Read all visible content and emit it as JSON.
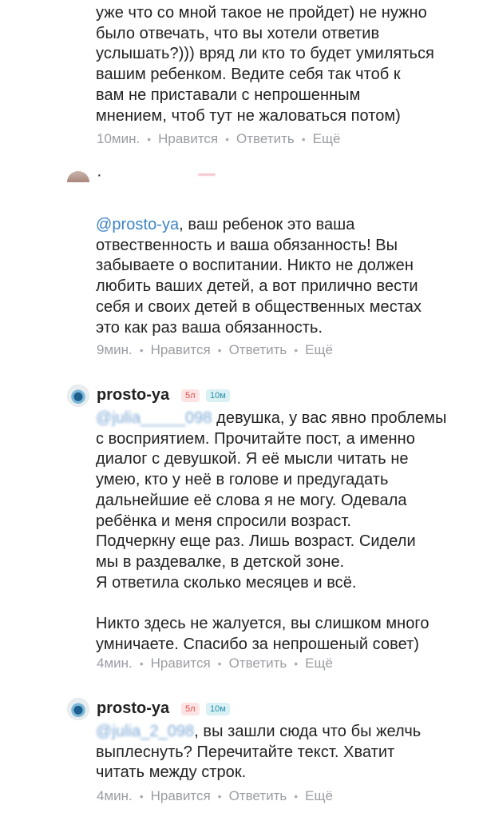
{
  "comments": [
    {
      "text": "уже что со мной такое не пройдет) не нужно\nбыло отвечать, что вы хотели ответив\nуслышать?))) вряд ли кто то будет умиляться\nвашим ребенком. Ведите себя так чтоб к\nвам не приставали с непрошенным\nмнением, чтоб тут не жаловаться потом)",
      "time": "10мин.",
      "like": "Нравится",
      "reply": "Ответить",
      "more": "Ещё"
    },
    {
      "username": "·",
      "mention": "@prosto-ya",
      "text": ", ваш ребенок это ваша\nотвественность и ваша обязанность! Вы\nзабываете о воспитании. Никто не должен\nлюбить ваших детей, а вот прилично вести\nсебя и своих детей в общественных местах\nэто как раз ваша обязанность.",
      "time": "9мин.",
      "like": "Нравится",
      "reply": "Ответить",
      "more": "Ещё"
    },
    {
      "username": "prosto-ya",
      "badge_red": "5л",
      "badge_blue": "10м",
      "mention": "@julia_____098",
      "text": " девушка, у вас явно проблемы\nс восприятием. Прочитайте пост, а именно\nдиалог с девушкой. Я её мысли читать не\nумею, кто у неё в голове и предугадать\nдальнейшие её слова я не могу. Одевала\nребёнка и меня спросили возраст.\nПодчеркну еще раз. Лишь возраст. Сидели\nмы в раздевалке, в детской зоне.\nЯ ответила сколько месяцев и всё.\n\nНикто здесь не жалуется, вы слишком много\nумничаете. Спасибо за непрошеный совет)",
      "time": "4мин.",
      "like": "Нравится",
      "reply": "Ответить",
      "more": "Ещё"
    },
    {
      "username": "prosto-ya",
      "badge_red": "5л",
      "badge_blue": "10м",
      "mention": "@julia_2_098",
      "text": ", вы зашли сюда что бы желчь\nвыплеснуть? Перечитайте текст. Хватит\nчитать между строк.",
      "time": "4мин.",
      "like": "Нравится",
      "reply": "Ответить",
      "more": "Ещё"
    }
  ]
}
